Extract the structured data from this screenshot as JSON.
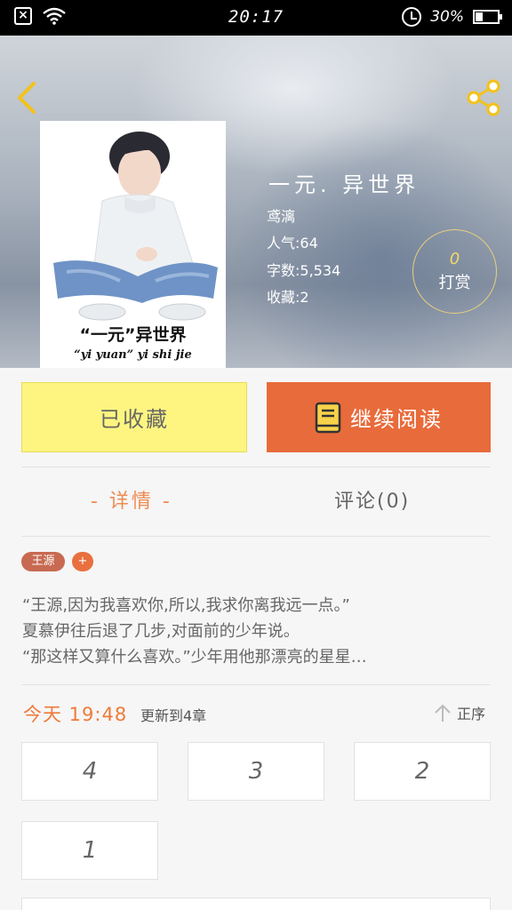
{
  "status_bar": {
    "time": "20:17",
    "battery": "30%",
    "battery_level": 0.3
  },
  "book": {
    "title": "一元. 异世界",
    "author": "鸢漓",
    "popularity": "人气:64",
    "word_count": "字数:5,534",
    "favorites": "收藏:2",
    "cover_title": "“一元”异世界",
    "cover_subtitle": "“yi yuan” yi shi jie"
  },
  "reward": {
    "count": "0",
    "label": "打赏"
  },
  "actions": {
    "collected_label": "已收藏",
    "read_label": "继续阅读"
  },
  "tabs": {
    "details": "- 详情 -",
    "comments": "评论(0)"
  },
  "tags": {
    "author_tag": "王源",
    "add": "+"
  },
  "synopsis": {
    "line1": "“王源,因为我喜欢你,所以,我求你离我远一点。”",
    "line2": "夏慕伊往后退了几步,对面前的少年说。",
    "line3": "“那这样又算什么喜欢。”少年用他那漂亮的星星…"
  },
  "update": {
    "time": "今天 19:48",
    "text": "更新到4章",
    "sort_label": "正序"
  },
  "chapters": [
    "4",
    "3",
    "2",
    "1"
  ],
  "colors": {
    "accent_orange": "#e86b3b",
    "collected_yellow": "#fdf580",
    "reward_gold": "#e8cf7c"
  }
}
